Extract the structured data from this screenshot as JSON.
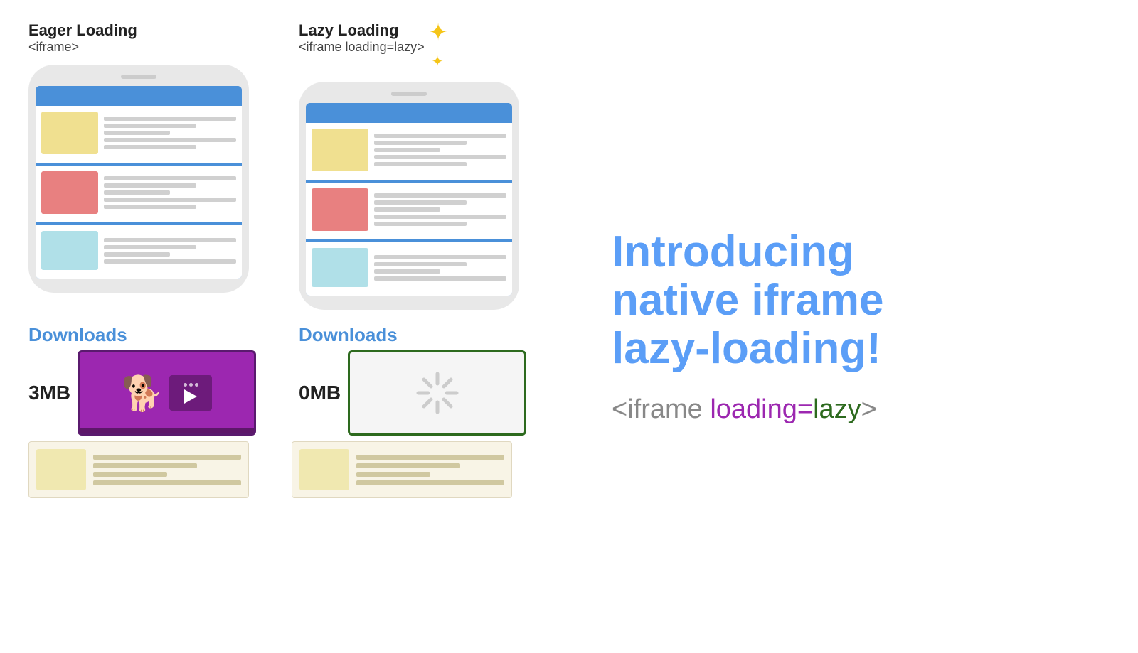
{
  "header": {
    "eager_title": "Eager Loading",
    "eager_code": "<iframe>",
    "lazy_title": "Lazy Loading",
    "lazy_code": "<iframe loading=lazy>"
  },
  "intro": {
    "line1": "Introducing",
    "line2": "native iframe",
    "line3": "lazy-loading!"
  },
  "code_snippet": {
    "part1": "<iframe",
    "part2": " loading=",
    "part3": "lazy",
    "part4": ">"
  },
  "downloads": {
    "eager": {
      "label": "Downloads",
      "size": "3MB"
    },
    "lazy": {
      "label": "Downloads",
      "size": "0MB"
    }
  },
  "colors": {
    "blue": "#5b9ef7",
    "purple": "#9c27b0",
    "green": "#2d6a1e",
    "gray": "#888888",
    "yellow": "#f5c518"
  }
}
